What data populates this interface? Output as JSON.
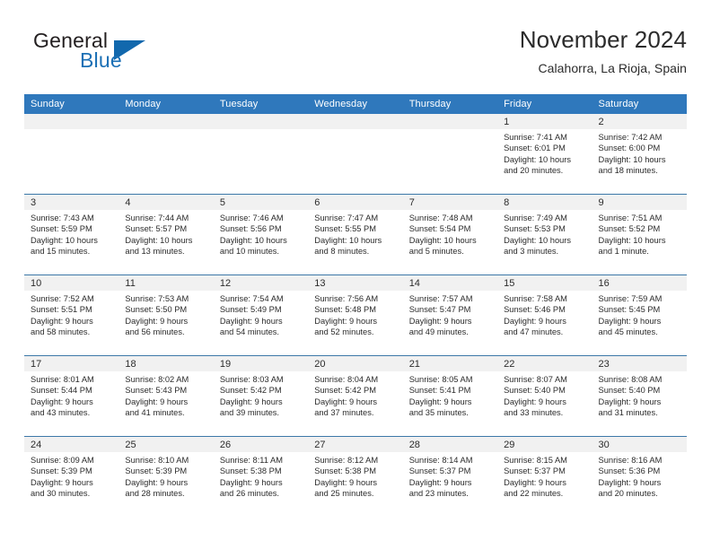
{
  "brand": {
    "word1": "General",
    "word2": "Blue",
    "accent_color": "#1268ad",
    "triangle_icon": "triangle-right-icon"
  },
  "header": {
    "title": "November 2024",
    "subtitle": "Calahorra, La Rioja, Spain"
  },
  "calendar": {
    "header_bg": "#2f78bc",
    "daynum_bg": "#f1f1f1",
    "grid_line": "#3c78a8",
    "weekdays": [
      "Sunday",
      "Monday",
      "Tuesday",
      "Wednesday",
      "Thursday",
      "Friday",
      "Saturday"
    ],
    "weeks": [
      [
        {
          "day": "",
          "sunrise": "",
          "sunset": "",
          "daylight1": "",
          "daylight2": "",
          "empty": true
        },
        {
          "day": "",
          "sunrise": "",
          "sunset": "",
          "daylight1": "",
          "daylight2": "",
          "empty": true
        },
        {
          "day": "",
          "sunrise": "",
          "sunset": "",
          "daylight1": "",
          "daylight2": "",
          "empty": true
        },
        {
          "day": "",
          "sunrise": "",
          "sunset": "",
          "daylight1": "",
          "daylight2": "",
          "empty": true
        },
        {
          "day": "",
          "sunrise": "",
          "sunset": "",
          "daylight1": "",
          "daylight2": "",
          "empty": true
        },
        {
          "day": "1",
          "sunrise": "Sunrise: 7:41 AM",
          "sunset": "Sunset: 6:01 PM",
          "daylight1": "Daylight: 10 hours",
          "daylight2": "and 20 minutes."
        },
        {
          "day": "2",
          "sunrise": "Sunrise: 7:42 AM",
          "sunset": "Sunset: 6:00 PM",
          "daylight1": "Daylight: 10 hours",
          "daylight2": "and 18 minutes."
        }
      ],
      [
        {
          "day": "3",
          "sunrise": "Sunrise: 7:43 AM",
          "sunset": "Sunset: 5:59 PM",
          "daylight1": "Daylight: 10 hours",
          "daylight2": "and 15 minutes."
        },
        {
          "day": "4",
          "sunrise": "Sunrise: 7:44 AM",
          "sunset": "Sunset: 5:57 PM",
          "daylight1": "Daylight: 10 hours",
          "daylight2": "and 13 minutes."
        },
        {
          "day": "5",
          "sunrise": "Sunrise: 7:46 AM",
          "sunset": "Sunset: 5:56 PM",
          "daylight1": "Daylight: 10 hours",
          "daylight2": "and 10 minutes."
        },
        {
          "day": "6",
          "sunrise": "Sunrise: 7:47 AM",
          "sunset": "Sunset: 5:55 PM",
          "daylight1": "Daylight: 10 hours",
          "daylight2": "and 8 minutes."
        },
        {
          "day": "7",
          "sunrise": "Sunrise: 7:48 AM",
          "sunset": "Sunset: 5:54 PM",
          "daylight1": "Daylight: 10 hours",
          "daylight2": "and 5 minutes."
        },
        {
          "day": "8",
          "sunrise": "Sunrise: 7:49 AM",
          "sunset": "Sunset: 5:53 PM",
          "daylight1": "Daylight: 10 hours",
          "daylight2": "and 3 minutes."
        },
        {
          "day": "9",
          "sunrise": "Sunrise: 7:51 AM",
          "sunset": "Sunset: 5:52 PM",
          "daylight1": "Daylight: 10 hours",
          "daylight2": "and 1 minute."
        }
      ],
      [
        {
          "day": "10",
          "sunrise": "Sunrise: 7:52 AM",
          "sunset": "Sunset: 5:51 PM",
          "daylight1": "Daylight: 9 hours",
          "daylight2": "and 58 minutes."
        },
        {
          "day": "11",
          "sunrise": "Sunrise: 7:53 AM",
          "sunset": "Sunset: 5:50 PM",
          "daylight1": "Daylight: 9 hours",
          "daylight2": "and 56 minutes."
        },
        {
          "day": "12",
          "sunrise": "Sunrise: 7:54 AM",
          "sunset": "Sunset: 5:49 PM",
          "daylight1": "Daylight: 9 hours",
          "daylight2": "and 54 minutes."
        },
        {
          "day": "13",
          "sunrise": "Sunrise: 7:56 AM",
          "sunset": "Sunset: 5:48 PM",
          "daylight1": "Daylight: 9 hours",
          "daylight2": "and 52 minutes."
        },
        {
          "day": "14",
          "sunrise": "Sunrise: 7:57 AM",
          "sunset": "Sunset: 5:47 PM",
          "daylight1": "Daylight: 9 hours",
          "daylight2": "and 49 minutes."
        },
        {
          "day": "15",
          "sunrise": "Sunrise: 7:58 AM",
          "sunset": "Sunset: 5:46 PM",
          "daylight1": "Daylight: 9 hours",
          "daylight2": "and 47 minutes."
        },
        {
          "day": "16",
          "sunrise": "Sunrise: 7:59 AM",
          "sunset": "Sunset: 5:45 PM",
          "daylight1": "Daylight: 9 hours",
          "daylight2": "and 45 minutes."
        }
      ],
      [
        {
          "day": "17",
          "sunrise": "Sunrise: 8:01 AM",
          "sunset": "Sunset: 5:44 PM",
          "daylight1": "Daylight: 9 hours",
          "daylight2": "and 43 minutes."
        },
        {
          "day": "18",
          "sunrise": "Sunrise: 8:02 AM",
          "sunset": "Sunset: 5:43 PM",
          "daylight1": "Daylight: 9 hours",
          "daylight2": "and 41 minutes."
        },
        {
          "day": "19",
          "sunrise": "Sunrise: 8:03 AM",
          "sunset": "Sunset: 5:42 PM",
          "daylight1": "Daylight: 9 hours",
          "daylight2": "and 39 minutes."
        },
        {
          "day": "20",
          "sunrise": "Sunrise: 8:04 AM",
          "sunset": "Sunset: 5:42 PM",
          "daylight1": "Daylight: 9 hours",
          "daylight2": "and 37 minutes."
        },
        {
          "day": "21",
          "sunrise": "Sunrise: 8:05 AM",
          "sunset": "Sunset: 5:41 PM",
          "daylight1": "Daylight: 9 hours",
          "daylight2": "and 35 minutes."
        },
        {
          "day": "22",
          "sunrise": "Sunrise: 8:07 AM",
          "sunset": "Sunset: 5:40 PM",
          "daylight1": "Daylight: 9 hours",
          "daylight2": "and 33 minutes."
        },
        {
          "day": "23",
          "sunrise": "Sunrise: 8:08 AM",
          "sunset": "Sunset: 5:40 PM",
          "daylight1": "Daylight: 9 hours",
          "daylight2": "and 31 minutes."
        }
      ],
      [
        {
          "day": "24",
          "sunrise": "Sunrise: 8:09 AM",
          "sunset": "Sunset: 5:39 PM",
          "daylight1": "Daylight: 9 hours",
          "daylight2": "and 30 minutes."
        },
        {
          "day": "25",
          "sunrise": "Sunrise: 8:10 AM",
          "sunset": "Sunset: 5:39 PM",
          "daylight1": "Daylight: 9 hours",
          "daylight2": "and 28 minutes."
        },
        {
          "day": "26",
          "sunrise": "Sunrise: 8:11 AM",
          "sunset": "Sunset: 5:38 PM",
          "daylight1": "Daylight: 9 hours",
          "daylight2": "and 26 minutes."
        },
        {
          "day": "27",
          "sunrise": "Sunrise: 8:12 AM",
          "sunset": "Sunset: 5:38 PM",
          "daylight1": "Daylight: 9 hours",
          "daylight2": "and 25 minutes."
        },
        {
          "day": "28",
          "sunrise": "Sunrise: 8:14 AM",
          "sunset": "Sunset: 5:37 PM",
          "daylight1": "Daylight: 9 hours",
          "daylight2": "and 23 minutes."
        },
        {
          "day": "29",
          "sunrise": "Sunrise: 8:15 AM",
          "sunset": "Sunset: 5:37 PM",
          "daylight1": "Daylight: 9 hours",
          "daylight2": "and 22 minutes."
        },
        {
          "day": "30",
          "sunrise": "Sunrise: 8:16 AM",
          "sunset": "Sunset: 5:36 PM",
          "daylight1": "Daylight: 9 hours",
          "daylight2": "and 20 minutes."
        }
      ]
    ]
  }
}
